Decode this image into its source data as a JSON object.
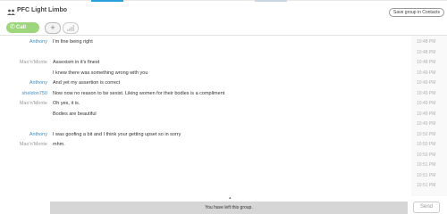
{
  "header": {
    "title": "PFC Light Limbo",
    "save_label": "Save group in Contacts"
  },
  "toolbar": {
    "call_label": "Call group",
    "add_label": "+"
  },
  "colors": {
    "accent_blue": "#2aa0dc",
    "call_green": "#9ed67e",
    "sender_blue": "#3a8fd1",
    "sender_gray": "#9a9a9a"
  },
  "messages": [
    {
      "sender": "Anthony",
      "sender_color": "#3a8fd1",
      "text": "I'm fine being right",
      "time": "10:48 PM"
    },
    {
      "sender": "",
      "sender_color": "#9a9a9a",
      "text": "",
      "time": "10:48 PM"
    },
    {
      "sender": "Mao'n'Monte",
      "sender_color": "#9a9a9a",
      "text": "Assexism in it's finest",
      "time": "10:48 PM"
    },
    {
      "sender": "",
      "sender_color": "#9a9a9a",
      "text": "I knew there was something wrong with you",
      "time": "10:49 PM"
    },
    {
      "sender": "Anthony",
      "sender_color": "#3a8fd1",
      "text": "And yet my assertion is correct",
      "time": "10:49 PM"
    },
    {
      "sender": "sheldon750",
      "sender_color": "#3a8fd1",
      "text": "Now now no reason to be sexist.  Liking women for their bodies is a compliment",
      "time": "10:49 PM"
    },
    {
      "sender": "Mao'n'Monte",
      "sender_color": "#9a9a9a",
      "text": "Oh yes, it is.",
      "time": "10:49 PM"
    },
    {
      "sender": "",
      "sender_color": "#9a9a9a",
      "text": "Bodies are beautiful",
      "time": "10:49 PM"
    },
    {
      "sender": "",
      "sender_color": "#9a9a9a",
      "text": "",
      "time": "10:49 PM"
    },
    {
      "sender": "Anthony",
      "sender_color": "#3a8fd1",
      "text": "I was goofing a bit and I think your getting upset so in sorry",
      "time": "10:50 PM"
    },
    {
      "sender": "Mao'n'Monte",
      "sender_color": "#9a9a9a",
      "text": "mhm.",
      "time": "10:50 PM"
    },
    {
      "sender": "",
      "sender_color": "#9a9a9a",
      "text": "",
      "time": "10:50 PM"
    },
    {
      "sender": "",
      "sender_color": "#9a9a9a",
      "text": "",
      "time": "10:51 PM"
    },
    {
      "sender": "",
      "sender_color": "#9a9a9a",
      "text": "",
      "time": "10:51 PM"
    },
    {
      "sender": "",
      "sender_color": "#9a9a9a",
      "text": "",
      "time": "10:51 PM"
    }
  ],
  "composer": {
    "status_text": "You have left this group.",
    "send_label": "Send"
  },
  "icons": {
    "group": "group-icon",
    "phone": "phone-icon",
    "signal": "signal-icon"
  }
}
